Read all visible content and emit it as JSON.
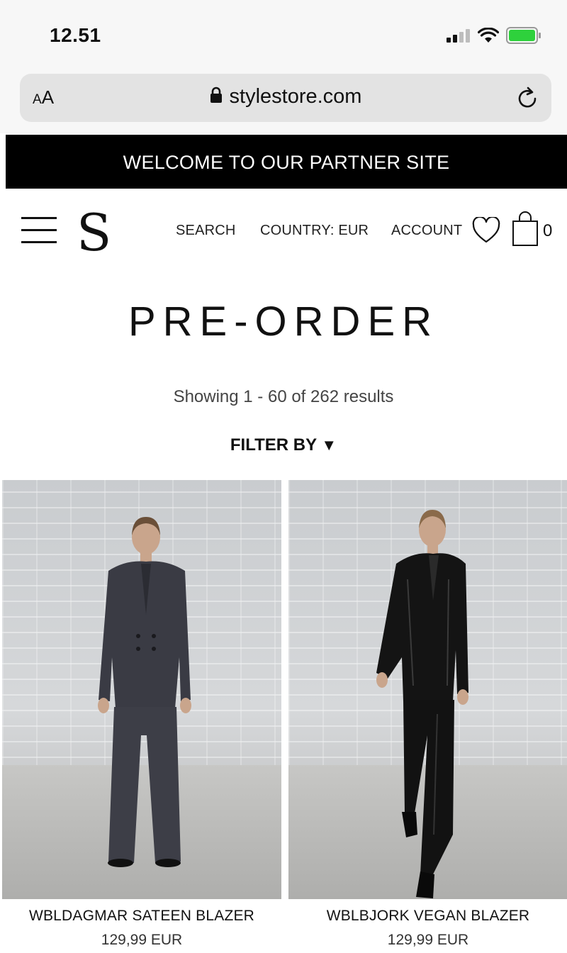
{
  "status_bar": {
    "time": "12.51"
  },
  "browser": {
    "aa_small": "A",
    "aa_large": "A",
    "url": "stylestore.com"
  },
  "banner": {
    "text": "WELCOME TO OUR PARTNER SITE"
  },
  "nav": {
    "logo": "S",
    "search": "SEARCH",
    "country": "COUNTRY: EUR",
    "account": "ACCOUNT",
    "cart_count": "0"
  },
  "page": {
    "title": "PRE-ORDER",
    "results": "Showing 1 - 60 of 262 results",
    "filter_label": "FILTER BY",
    "filter_arrow": "▼"
  },
  "products": [
    {
      "name": "WBLDAGMAR SATEEN BLAZER",
      "price": "129,99 EUR",
      "color": "#3a3b44"
    },
    {
      "name": "WBLBJORK VEGAN BLAZER",
      "price": "129,99 EUR",
      "color": "#141414"
    }
  ]
}
